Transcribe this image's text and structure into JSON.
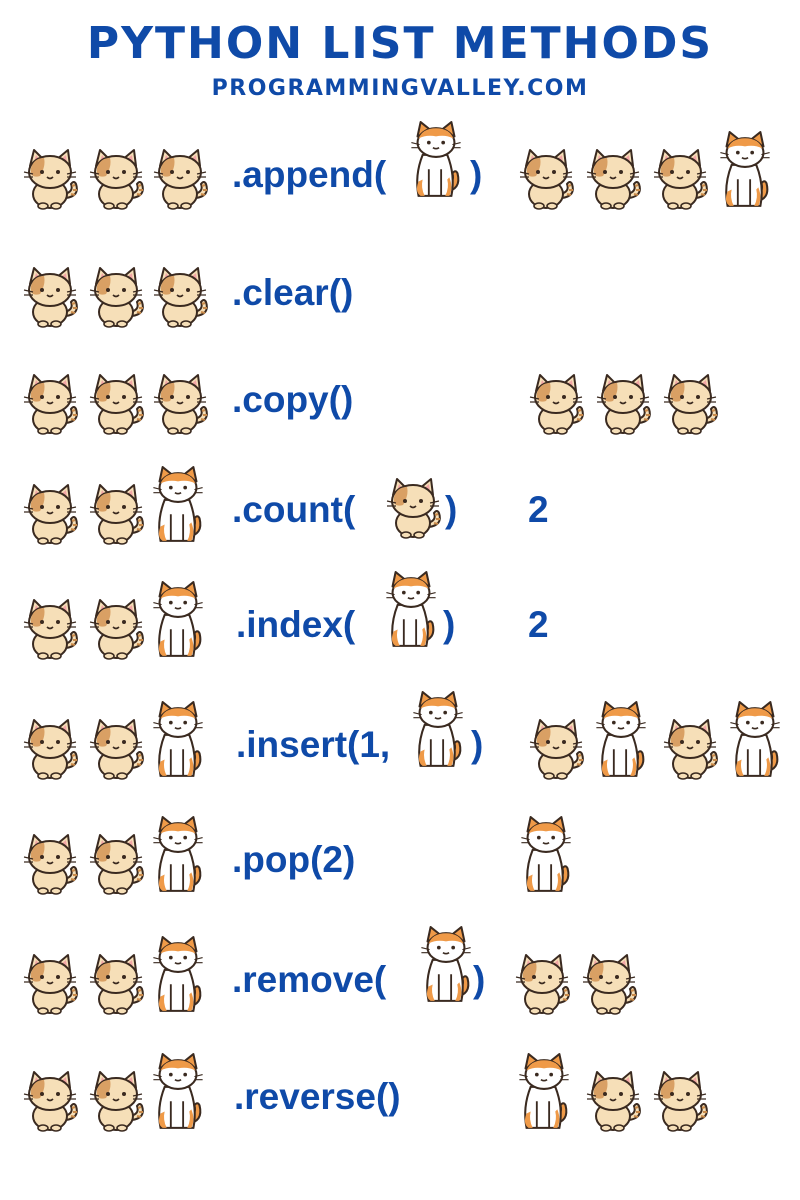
{
  "header": {
    "title": "PYTHON LIST METHODS",
    "subtitle": "PROGRAMMINGVALLEY.COM"
  },
  "colors": {
    "text": "#0f4aa8",
    "cat_tan": "#f6dfb8",
    "cat_orange": "#ef9a48",
    "cat_outline": "#3a2a20"
  },
  "rows": [
    {
      "input": [
        "tan-cat-icon",
        "tan-cat-icon",
        "tan-cat-icon"
      ],
      "method_open": ".append(",
      "arg_cat": "orange-white-cat-icon",
      "method_close": ")",
      "result": [
        "tan-cat-icon",
        "tan-cat-icon",
        "tan-cat-icon",
        "orange-white-cat-icon"
      ]
    },
    {
      "input": [
        "tan-cat-icon",
        "tan-cat-icon",
        "tan-cat-icon"
      ],
      "method_open": ".clear()",
      "result": []
    },
    {
      "input": [
        "tan-cat-icon",
        "tan-cat-icon",
        "tan-cat-icon"
      ],
      "method_open": ".copy()",
      "result": [
        "tan-cat-icon",
        "tan-cat-icon",
        "tan-cat-icon"
      ]
    },
    {
      "input": [
        "tan-cat-icon",
        "tan-cat-icon",
        "orange-white-cat-icon"
      ],
      "method_open": ".count(",
      "arg_cat": "tan-cat-icon",
      "method_close": ")",
      "result_text": "2"
    },
    {
      "input": [
        "tan-cat-icon",
        "tan-cat-icon",
        "orange-white-cat-icon"
      ],
      "method_open": ".index(",
      "arg_cat": "orange-white-cat-icon",
      "method_close": ")",
      "result_text": "2"
    },
    {
      "input": [
        "tan-cat-icon",
        "tan-cat-icon",
        "orange-white-cat-icon"
      ],
      "method_open": ".insert(1,",
      "arg_cat": "orange-white-cat-icon",
      "method_close": ")",
      "result": [
        "tan-cat-icon",
        "orange-white-cat-icon",
        "tan-cat-icon",
        "orange-white-cat-icon"
      ]
    },
    {
      "input": [
        "tan-cat-icon",
        "tan-cat-icon",
        "orange-white-cat-icon"
      ],
      "method_open": ".pop(2)",
      "result": [
        "orange-white-cat-icon"
      ]
    },
    {
      "input": [
        "tan-cat-icon",
        "tan-cat-icon",
        "orange-white-cat-icon"
      ],
      "method_open": ".remove(",
      "arg_cat": "orange-white-cat-icon",
      "method_close": ")",
      "result": [
        "tan-cat-icon",
        "tan-cat-icon"
      ]
    },
    {
      "input": [
        "tan-cat-icon",
        "tan-cat-icon",
        "orange-white-cat-icon"
      ],
      "method_open": ".reverse()",
      "result": [
        "orange-white-cat-icon",
        "tan-cat-icon",
        "tan-cat-icon"
      ]
    }
  ]
}
